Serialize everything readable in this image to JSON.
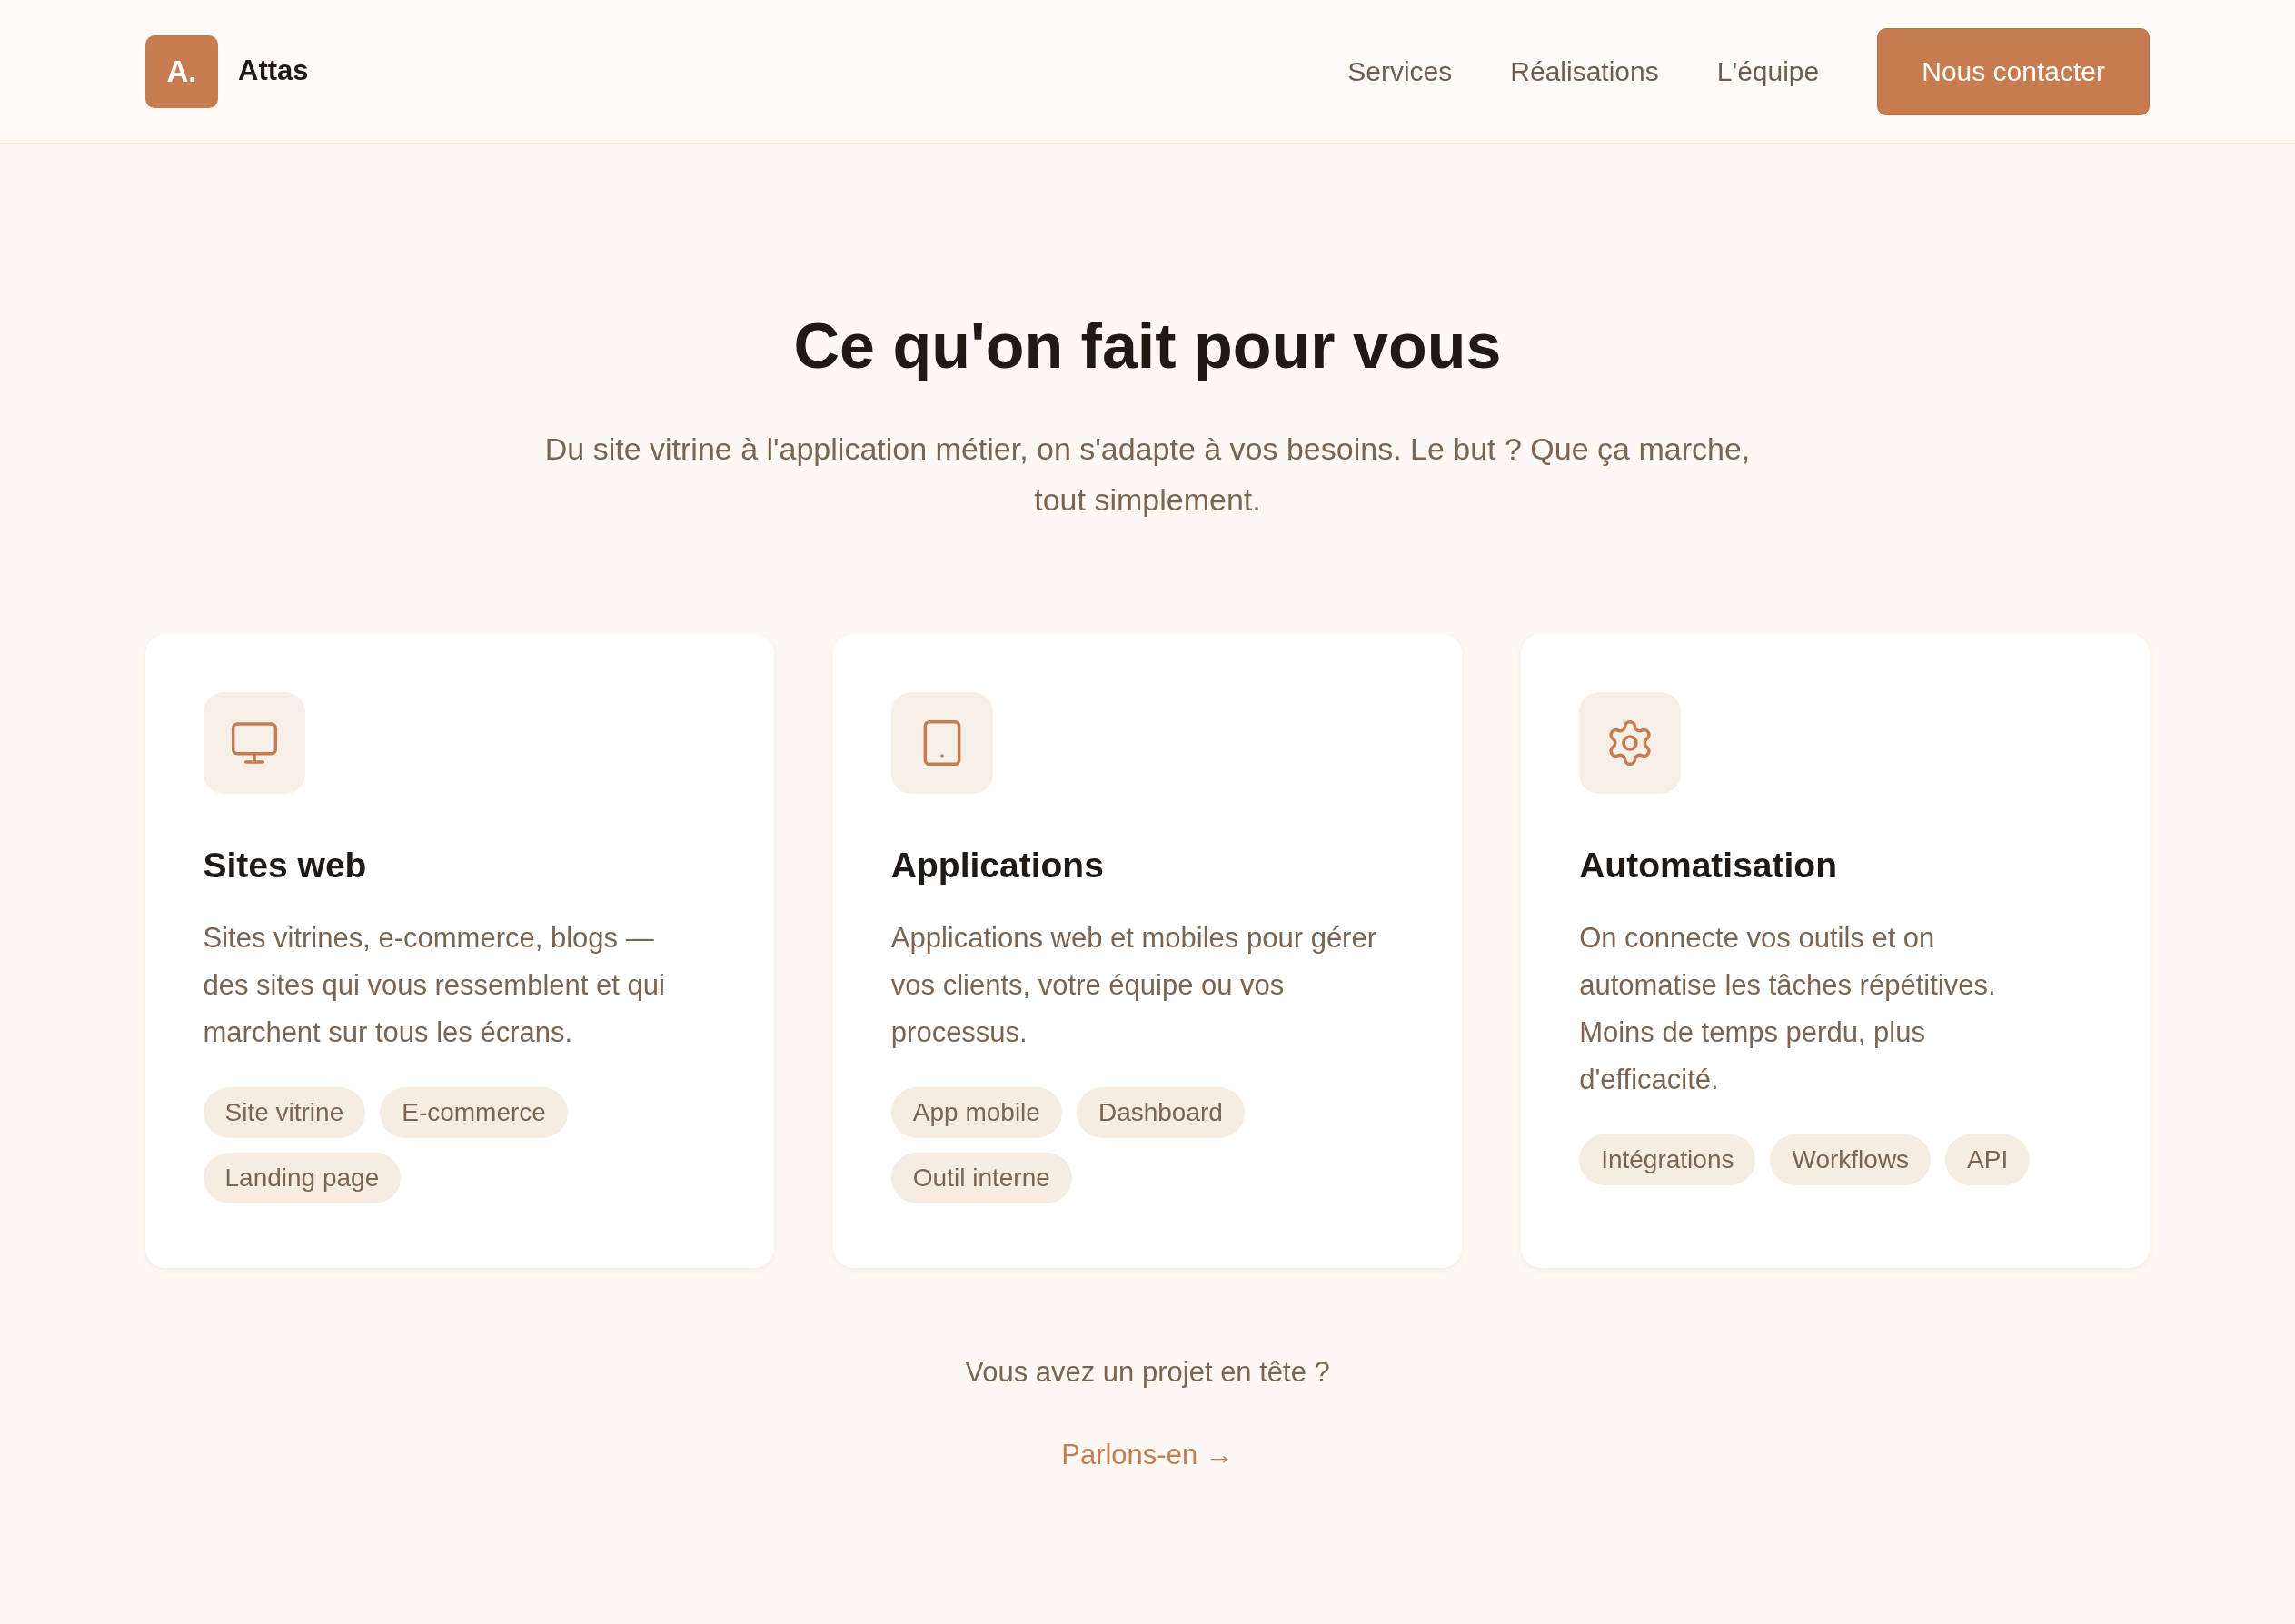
{
  "header": {
    "logo_mark": "A.",
    "brand": "Attas",
    "nav": [
      "Services",
      "Réalisations",
      "L'équipe"
    ],
    "cta": "Nous contacter"
  },
  "section": {
    "title": "Ce qu'on fait pour vous",
    "subtitle": "Du site vitrine à l'application métier, on s'adapte à vos besoins. Le but ? Que ça marche, tout simplement."
  },
  "cards": [
    {
      "kind": "monitor",
      "title": "Sites web",
      "description": "Sites vitrines, e-commerce, blogs — des sites qui vous ressemblent et qui marchent sur tous les écrans.",
      "tags": [
        "Site vitrine",
        "E-commerce",
        "Landing page"
      ]
    },
    {
      "kind": "tablet",
      "title": "Applications",
      "description": "Applications web et mobiles pour gérer vos clients, votre équipe ou vos processus.",
      "tags": [
        "App mobile",
        "Dashboard",
        "Outil interne"
      ]
    },
    {
      "kind": "gear",
      "title": "Automatisation",
      "description": "On connecte vos outils et on automatise les tâches répétitives. Moins de temps perdu, plus d'efficacité.",
      "tags": [
        "Intégrations",
        "Workflows",
        "API"
      ]
    }
  ],
  "cta_section": {
    "question": "Vous avez un projet en tête ?",
    "link": "Parlons-en →"
  }
}
